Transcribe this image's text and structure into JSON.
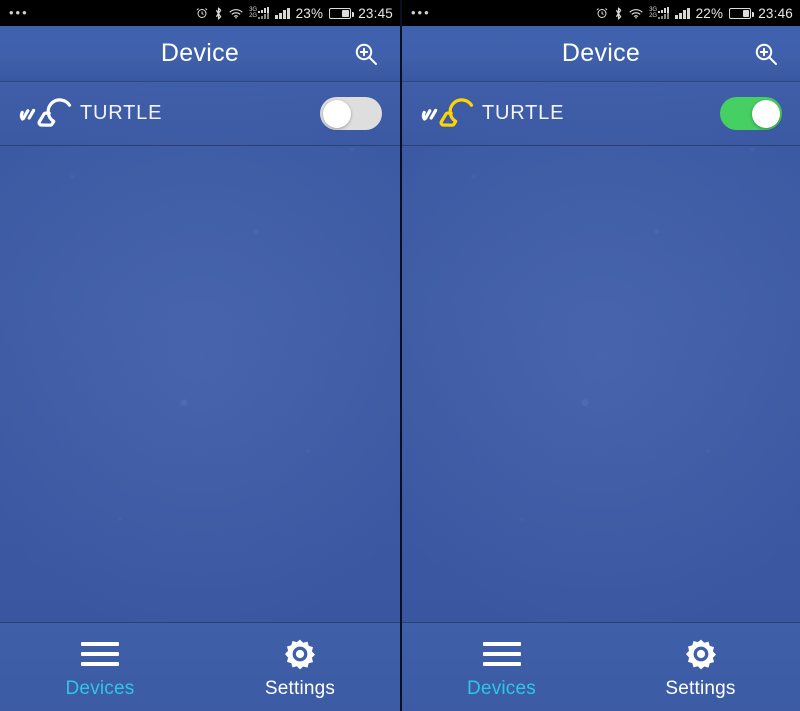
{
  "app": {
    "title": "Device"
  },
  "colors": {
    "background_blue": "#3b5aa3",
    "titlebar_blue": "#4062ae",
    "toggle_on_green": "#46cf63",
    "toggle_off_gray": "#dedede",
    "active_tab_cyan": "#2ec6e8",
    "bulb_on_yellow": "#FFD400",
    "bulb_off_white": "#ffffff",
    "statusbar_black": "#000000"
  },
  "panels": [
    {
      "id": "left",
      "statusbar": {
        "overflow_dots": "•••",
        "icons": [
          "alarm-icon",
          "bluetooth-icon",
          "wifi-icon",
          "mobile-3g-2g-signal-icon",
          "signal-bars-icon"
        ],
        "network_labels": {
          "primary": "3G",
          "secondary": "2G"
        },
        "battery_percent": "23%",
        "time": "23:45"
      },
      "titlebar": {
        "title": "Device",
        "search_icon": "zoom-in-search-icon"
      },
      "device": {
        "name": "TURTLE",
        "bulb_icon": "light-bulb-off-icon",
        "bulb_state": "off",
        "toggle_state": "off",
        "toggle_label": "Off"
      },
      "bottom_nav": [
        {
          "label": "Devices",
          "icon": "hamburger-menu-icon",
          "active": true
        },
        {
          "label": "Settings",
          "icon": "gear-icon",
          "active": false
        }
      ]
    },
    {
      "id": "right",
      "statusbar": {
        "overflow_dots": "•••",
        "icons": [
          "alarm-icon",
          "bluetooth-icon",
          "wifi-icon",
          "mobile-3g-2g-signal-icon",
          "signal-bars-icon"
        ],
        "network_labels": {
          "primary": "3G",
          "secondary": "2G"
        },
        "battery_percent": "22%",
        "time": "23:46"
      },
      "titlebar": {
        "title": "Device",
        "search_icon": "zoom-in-search-icon"
      },
      "device": {
        "name": "TURTLE",
        "bulb_icon": "light-bulb-on-icon",
        "bulb_state": "on",
        "toggle_state": "on",
        "toggle_label": "On"
      },
      "bottom_nav": [
        {
          "label": "Devices",
          "icon": "hamburger-menu-icon",
          "active": true
        },
        {
          "label": "Settings",
          "icon": "gear-icon",
          "active": false
        }
      ]
    }
  ]
}
